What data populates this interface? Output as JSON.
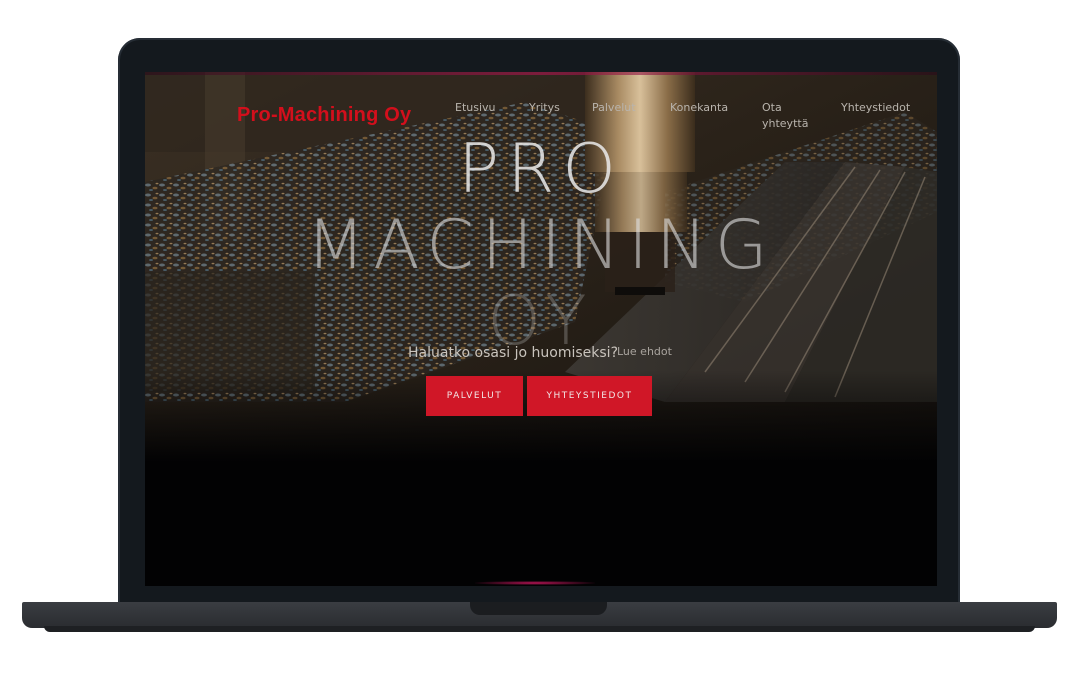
{
  "brand": "Pro-Machining Oy",
  "nav": {
    "items": [
      {
        "label": "Etusivu"
      },
      {
        "label": "Yritys"
      },
      {
        "label": "Palvelut"
      },
      {
        "label": "Konekanta"
      },
      {
        "label": "Ota yhteyttä"
      },
      {
        "label": "Yhteystiedot"
      }
    ]
  },
  "hero": {
    "title_line1": "PRO",
    "title_line2": "MACHINING",
    "title_line3": "OY",
    "subtitle": "Haluatko osasi jo huomiseksi?",
    "link": "Lue ehdot",
    "buttons": {
      "services": "PALVELUT",
      "contact": "YHTEYSTIEDOT"
    }
  },
  "colors": {
    "accent": "#d01727",
    "brand": "#d30f1c",
    "background": "#020203"
  }
}
